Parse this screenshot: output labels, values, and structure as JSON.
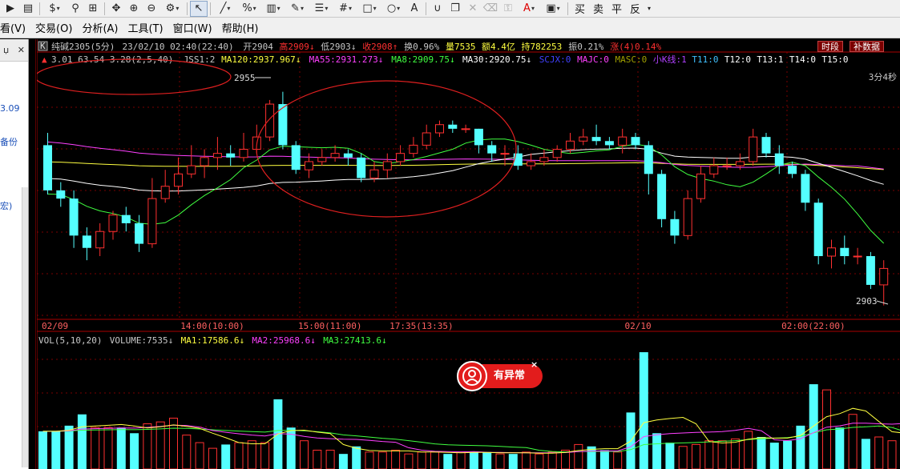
{
  "toolbar": {
    "buttons": [
      {
        "icon": "play-icon",
        "glyph": "▶"
      },
      {
        "icon": "document-icon",
        "glyph": "▤"
      },
      {
        "icon": "dollar-icon",
        "glyph": "$",
        "drop": true
      },
      {
        "icon": "filter-icon",
        "glyph": "⚲"
      },
      {
        "icon": "grid-icon",
        "glyph": "⊞"
      },
      {
        "icon": "move-icon",
        "glyph": "✥"
      },
      {
        "icon": "zoom-in-icon",
        "glyph": "⊕"
      },
      {
        "icon": "zoom-out-icon",
        "glyph": "⊖"
      },
      {
        "icon": "gear-icon",
        "glyph": "⚙",
        "drop": true
      },
      {
        "icon": "cursor-icon",
        "glyph": "↖",
        "selected": true
      },
      {
        "icon": "line-icon",
        "glyph": "╱",
        "drop": true
      },
      {
        "icon": "percent-icon",
        "glyph": "%",
        "drop": true
      },
      {
        "icon": "ruler-icon",
        "glyph": "▥",
        "drop": true
      },
      {
        "icon": "pen-icon",
        "glyph": "✎",
        "drop": true
      },
      {
        "icon": "channel-icon",
        "glyph": "☰",
        "drop": true
      },
      {
        "icon": "hash-icon",
        "glyph": "#",
        "drop": true
      },
      {
        "icon": "rectangle-icon",
        "glyph": "□",
        "drop": true
      },
      {
        "icon": "circle-icon",
        "glyph": "○",
        "drop": true
      },
      {
        "icon": "text-icon",
        "glyph": "A"
      },
      {
        "icon": "magnet-icon",
        "glyph": "∪"
      },
      {
        "icon": "copy-icon",
        "glyph": "❐"
      },
      {
        "icon": "close-icon",
        "glyph": "✕",
        "grey": true
      },
      {
        "icon": "trash-icon",
        "glyph": "⌫",
        "grey": true
      },
      {
        "icon": "lock-icon",
        "glyph": "⚿",
        "grey": true
      },
      {
        "icon": "font-color-icon",
        "glyph": "A",
        "red": true,
        "drop": true
      },
      {
        "icon": "save-icon",
        "glyph": "▣",
        "drop": true
      }
    ],
    "trade_buttons": [
      "买",
      "卖",
      "平",
      "反"
    ]
  },
  "menu": [
    "看(V)",
    "交易(O)",
    "分析(A)",
    "工具(T)",
    "窗口(W)",
    "帮助(H)"
  ],
  "left_panel": {
    "header_pin": "џ",
    "header_close": "✕",
    "values": [
      {
        "text": "3.09",
        "top": 80
      },
      {
        "text": "备份",
        "top": 120
      },
      {
        "text": "宏)",
        "top": 200
      }
    ]
  },
  "header": {
    "name": "纯碱2305(5分)",
    "datetime": "23/02/10 02:40(22:40)",
    "open": "开2904",
    "high": "高2909",
    "low": "低2903",
    "close": "收2908",
    "turnover_rate": "换0.96%",
    "volume": "量7535",
    "amount": "额4.4亿",
    "holding": "持782253",
    "amplitude": "振0.21%",
    "change": "涨(4)0.14%",
    "btn_period": "时段",
    "btn_add": "补数据"
  },
  "indicators": {
    "params": "3.01 63.54 3.28(2,5,40)",
    "jss": "JSS1:2",
    "ma120": "MA120:2937.967",
    "ma55": "MA55:2931.273",
    "ma8": "MA8:2909.75",
    "ma30": "MA30:2920.75",
    "others": [
      "SCJX:0",
      "MAJC:0",
      "MASC:0",
      "小K线:1",
      "T11:0",
      "T12:0",
      "T13:1",
      "T14:0",
      "T15:0"
    ],
    "countdown": "3分4秒"
  },
  "colors": {
    "up": "#ff3030",
    "down": "#54ffff",
    "ma120": "#ffff40",
    "ma55": "#ff40ff",
    "ma8": "#40ff40",
    "ma30": "#ffffff",
    "grid": "#7a0000",
    "axis_text": "#ff6060"
  },
  "price_axis": {
    "high_label": "2955",
    "low_label": "2903",
    "ymin": 2900,
    "ymax": 2960
  },
  "time_labels": [
    {
      "text": "02/09",
      "bar": 0
    },
    {
      "text": "14:00(10:00)",
      "bar": 11
    },
    {
      "text": "15:00(11:00)",
      "bar": 20
    },
    {
      "text": "17:35(13:35)",
      "bar": 27
    },
    {
      "text": "02/10",
      "bar": 45
    },
    {
      "text": "02:00(22:00)",
      "bar": 57
    }
  ],
  "volume_panel": {
    "title": "VOL(5,10,20)",
    "volume": "VOLUME:7535",
    "ma1": "MA1:17586.6",
    "ma2": "MA2:25968.6",
    "ma3": "MA3:27413.6"
  },
  "badge": {
    "label": "有异常",
    "close": "×"
  },
  "chart_data": {
    "type": "candlestick",
    "candles": [
      [
        2942,
        2931,
        2945,
        2930
      ],
      [
        2931,
        2929,
        2933,
        2927
      ],
      [
        2929,
        2920,
        2931,
        2917
      ],
      [
        2920,
        2917,
        2922,
        2914
      ],
      [
        2917,
        2921,
        2923,
        2915
      ],
      [
        2921,
        2925,
        2926,
        2919
      ],
      [
        2925,
        2923,
        2927,
        2921
      ],
      [
        2923,
        2918,
        2925,
        2916
      ],
      [
        2918,
        2929,
        2934,
        2917
      ],
      [
        2929,
        2932,
        2936,
        2928
      ],
      [
        2932,
        2935,
        2939,
        2930
      ],
      [
        2935,
        2937,
        2942,
        2934
      ],
      [
        2937,
        2939,
        2941,
        2934
      ],
      [
        2939,
        2940,
        2944,
        2936
      ],
      [
        2940,
        2939,
        2942,
        2937
      ],
      [
        2939,
        2941,
        2945,
        2938
      ],
      [
        2941,
        2944,
        2947,
        2940
      ],
      [
        2944,
        2952,
        2953,
        2943
      ],
      [
        2952,
        2942,
        2955,
        2941
      ],
      [
        2942,
        2936,
        2943,
        2935
      ],
      [
        2936,
        2938,
        2940,
        2934
      ],
      [
        2938,
        2939,
        2941,
        2937
      ],
      [
        2939,
        2940,
        2942,
        2938
      ],
      [
        2940,
        2939,
        2941,
        2937
      ],
      [
        2939,
        2934,
        2940,
        2933
      ],
      [
        2934,
        2936,
        2938,
        2933
      ],
      [
        2936,
        2938,
        2940,
        2934
      ],
      [
        2938,
        2940,
        2942,
        2937
      ],
      [
        2940,
        2942,
        2944,
        2939
      ],
      [
        2942,
        2945,
        2947,
        2941
      ],
      [
        2945,
        2947,
        2948,
        2944
      ],
      [
        2947,
        2946,
        2948,
        2945
      ],
      [
        2946,
        2946,
        2947,
        2945
      ],
      [
        2946,
        2942,
        2946,
        2940
      ],
      [
        2942,
        2940,
        2943,
        2938
      ],
      [
        2940,
        2940,
        2942,
        2937
      ],
      [
        2940,
        2937,
        2942,
        2936
      ],
      [
        2937,
        2938,
        2940,
        2936
      ],
      [
        2938,
        2939,
        2941,
        2937
      ],
      [
        2939,
        2941,
        2942,
        2938
      ],
      [
        2941,
        2943,
        2945,
        2940
      ],
      [
        2943,
        2944,
        2946,
        2942
      ],
      [
        2944,
        2943,
        2947,
        2942
      ],
      [
        2943,
        2942,
        2944,
        2941
      ],
      [
        2942,
        2944,
        2946,
        2940
      ],
      [
        2944,
        2942,
        2945,
        2941
      ],
      [
        2942,
        2935,
        2943,
        2930
      ],
      [
        2935,
        2924,
        2936,
        2922
      ],
      [
        2924,
        2920,
        2926,
        2918
      ],
      [
        2920,
        2929,
        2931,
        2919
      ],
      [
        2929,
        2935,
        2937,
        2928
      ],
      [
        2935,
        2937,
        2939,
        2934
      ],
      [
        2937,
        2937,
        2939,
        2936
      ],
      [
        2937,
        2938,
        2940,
        2936
      ],
      [
        2938,
        2944,
        2946,
        2937
      ],
      [
        2944,
        2940,
        2945,
        2939
      ],
      [
        2940,
        2937,
        2942,
        2935
      ],
      [
        2937,
        2935,
        2938,
        2934
      ],
      [
        2935,
        2928,
        2936,
        2926
      ],
      [
        2928,
        2915,
        2929,
        2913
      ],
      [
        2915,
        2917,
        2919,
        2912
      ],
      [
        2917,
        2915,
        2920,
        2913
      ],
      [
        2915,
        2915,
        2917,
        2913
      ],
      [
        2915,
        2908,
        2916,
        2907
      ],
      [
        2908,
        2912,
        2914,
        2903
      ]
    ],
    "volumes": [
      20,
      20,
      23,
      29,
      22,
      22,
      22,
      19,
      24,
      25,
      27,
      18,
      14,
      11,
      13,
      14,
      15,
      14,
      37,
      22,
      15,
      10,
      10,
      8,
      12,
      9,
      9,
      10,
      8,
      9,
      9,
      8,
      9,
      9,
      9,
      8,
      8,
      9,
      8,
      9,
      10,
      13,
      12,
      10,
      9,
      30,
      62,
      19,
      14,
      12,
      13,
      15,
      15,
      16,
      20,
      17,
      14,
      15,
      23,
      45,
      42,
      22,
      29,
      16,
      17,
      15,
      18
    ],
    "ylim": [
      2900,
      2960
    ]
  }
}
